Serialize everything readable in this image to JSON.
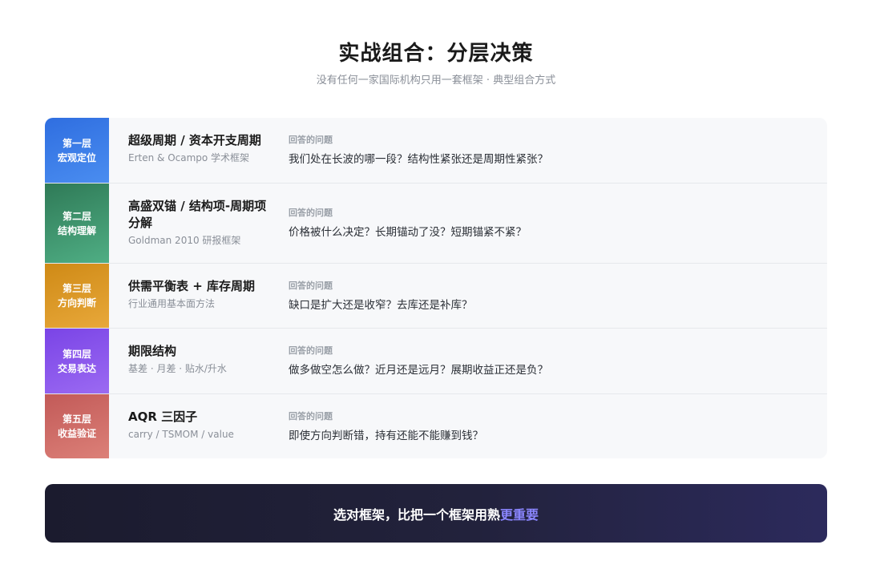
{
  "header": {
    "title": "实战组合：分层决策",
    "subtitle": "没有任何一家国际机构只用一套框架 · 典型组合方式"
  },
  "layers": [
    {
      "badge_line1": "第一层",
      "badge_line2": "宏观定位",
      "color_from": "#2f6ee0",
      "color_to": "#4a8df0",
      "method": "超级周期 / 资本开支周期",
      "source": "Erten & Ocampo 学术框架",
      "question_label": "回答的问题",
      "question": "我们处在长波的哪一段？结构性紧张还是周期性紧张？"
    },
    {
      "badge_line1": "第二层",
      "badge_line2": "结构理解",
      "color_from": "#2f7a57",
      "color_to": "#4fae84",
      "method": "高盛双锚 / 结构项-周期项分解",
      "source": "Goldman 2010 研报框架",
      "question_label": "回答的问题",
      "question": "价格被什么决定？长期锚动了没？短期锚紧不紧？"
    },
    {
      "badge_line1": "第三层",
      "badge_line2": "方向判断",
      "color_from": "#cf8a16",
      "color_to": "#e8a83a",
      "method": "供需平衡表 + 库存周期",
      "source": "行业通用基本面方法",
      "question_label": "回答的问题",
      "question": "缺口是扩大还是收窄？去库还是补库？"
    },
    {
      "badge_line1": "第四层",
      "badge_line2": "交易表达",
      "color_from": "#7a44e6",
      "color_to": "#9b6af2",
      "method": "期限结构",
      "source": "基差 · 月差 · 贴水/升水",
      "question_label": "回答的问题",
      "question": "做多做空怎么做？近月还是远月？展期收益正还是负？"
    },
    {
      "badge_line1": "第五层",
      "badge_line2": "收益验证",
      "color_from": "#c25a58",
      "color_to": "#dc8078",
      "method": "AQR 三因子",
      "source": "carry / TSMOM / value",
      "question_label": "回答的问题",
      "question": "即使方向判断错，持有还能不能赚到钱？"
    }
  ],
  "banner": {
    "text_main": "选对框架，比把一个框架用熟",
    "text_highlight": "更重要"
  }
}
